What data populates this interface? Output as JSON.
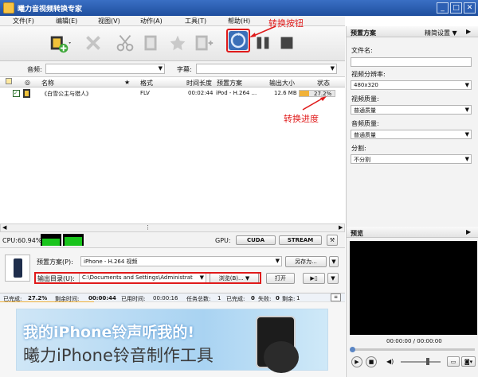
{
  "window": {
    "title": "曦力音视频转换专家"
  },
  "menu": [
    "文件(F)",
    "编辑(E)",
    "视图(V)",
    "动作(A)",
    "工具(T)",
    "帮助(H)"
  ],
  "filter": {
    "audio_label": "音频:",
    "audio_value": "",
    "subtitle_label": "字幕:",
    "subtitle_value": ""
  },
  "table": {
    "headers": [
      "名称",
      "★",
      "格式",
      "时间长度",
      "预置方案",
      "输出大小",
      "状态"
    ],
    "rows": [
      {
        "name": "《白雪公主与猎人》",
        "format": "FLV",
        "duration": "00:02:44",
        "preset": "iPod - H.264 ...",
        "size": "12.6 MB",
        "status": "27.2%",
        "progress": 0.272
      }
    ]
  },
  "cpu": {
    "label": "CPU:60.94%",
    "gpu_label": "GPU:",
    "cuda": "CUDA",
    "stream": "STREAM"
  },
  "settings": {
    "preset_label": "预置方案(P):",
    "preset_value": "iPhone - H.264 视频",
    "save_as": "另存为...",
    "output_label": "输出目录(U):",
    "output_value": "C:\\Documents and Settings\\Administrat",
    "browse": "浏览(B)...",
    "open": "打开"
  },
  "status": {
    "done_label": "已完成:",
    "done_value": "27.2%",
    "remaining_label": "剩余时间:",
    "remaining_value": "00:00:44",
    "elapsed_label": "已用时间:",
    "elapsed_value": "00:00:16",
    "total_label": "任务总数:",
    "total_value": "1",
    "completed_label": "已完成:",
    "completed_value": "0",
    "failed_label": "失败:",
    "failed_value": "0",
    "rest_label": "剩余:",
    "rest_value": "1"
  },
  "ad": {
    "line1": "我的iPhone铃声听我的!",
    "line2": "曦力iPhone铃音制作工具"
  },
  "right": {
    "preset_title": "预置方案",
    "fine_settings": "精简设置 ▼",
    "filename_label": "文件名:",
    "filename_value": "",
    "resolution_label": "视频分辨率:",
    "resolution_value": "480x320",
    "video_quality_label": "视频质量:",
    "video_quality_value": "普通质量",
    "audio_quality_label": "音频质量:",
    "audio_quality_value": "普通质量",
    "split_label": "分割:",
    "split_value": "不分割",
    "preview_title": "预览",
    "time": "00:00:00 / 00:00:00"
  },
  "annotations": {
    "convert_button": "转换按钮",
    "convert_progress": "转换进度"
  },
  "colors": {
    "accent": "#1f5fb8",
    "annotation": "#e01a1a",
    "progress": "#f0b23a"
  }
}
